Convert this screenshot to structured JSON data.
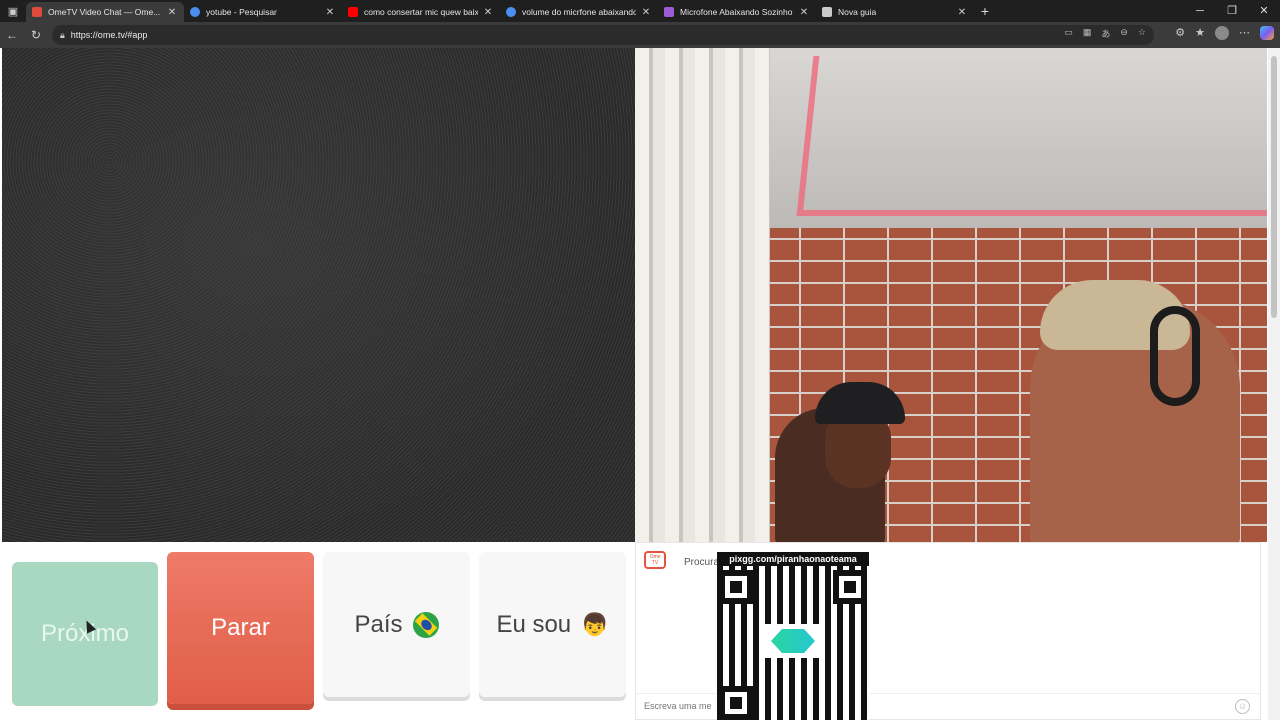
{
  "browser": {
    "tabs": [
      {
        "title": "OmeTV Video Chat — Ome...",
        "active": true,
        "favicon_color": "#e04a3a"
      },
      {
        "title": "yotube - Pesquisar",
        "active": false,
        "favicon_color": "#4a8ff0"
      },
      {
        "title": "como consertar mic quew baixa",
        "active": false,
        "favicon_color": "#ff0000"
      },
      {
        "title": "volume do micrfone abaixando s",
        "active": false,
        "favicon_color": "#4a8ff0"
      },
      {
        "title": "Microfone Abaixando Sozinho (S",
        "active": false,
        "favicon_color": "#9b5cd6"
      },
      {
        "title": "Nova guia",
        "active": false,
        "favicon_color": "#cccccc"
      }
    ],
    "url": "https://ome.tv/#app"
  },
  "controls": {
    "next_label": "Próximo",
    "stop_label": "Parar",
    "country_label": "País",
    "iam_label": "Eu sou",
    "iam_emoji": "👦"
  },
  "chat": {
    "status": "Procura",
    "input_placeholder": "Escreva uma me",
    "logo_text": "Ome TV"
  },
  "overlay": {
    "qr_url": "pixgg.com/piranhaonaoteama"
  },
  "colors": {
    "next": "#a8d8c0",
    "stop": "#e8664f",
    "accent": "#e6533f"
  }
}
